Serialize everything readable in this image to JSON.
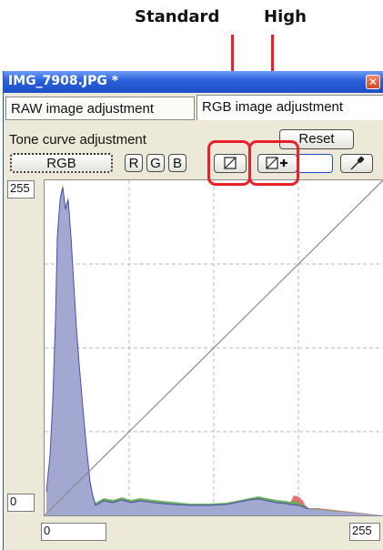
{
  "annotations": {
    "standard_label": "Standard",
    "high_label": "High",
    "accent_color": "#e8202a"
  },
  "window": {
    "title": "IMG_7908.JPG *",
    "close_glyph": "✕"
  },
  "tabs": [
    {
      "label": "RAW image adjustment",
      "active": false
    },
    {
      "label": "RGB image adjustment",
      "active": true
    }
  ],
  "tone_curve": {
    "section_label": "Tone curve adjustment",
    "reset_label": "Reset",
    "channel_buttons": [
      "RGB",
      "R",
      "G",
      "B"
    ],
    "selected_channel": "RGB",
    "standard_icon": "standard-curve-icon",
    "high_icon": "high-curve-icon",
    "pipette_icon": "eyedropper-icon"
  },
  "curve": {
    "y_max": "255",
    "y_min": "0",
    "x_min": "0",
    "x_max": "255"
  }
}
